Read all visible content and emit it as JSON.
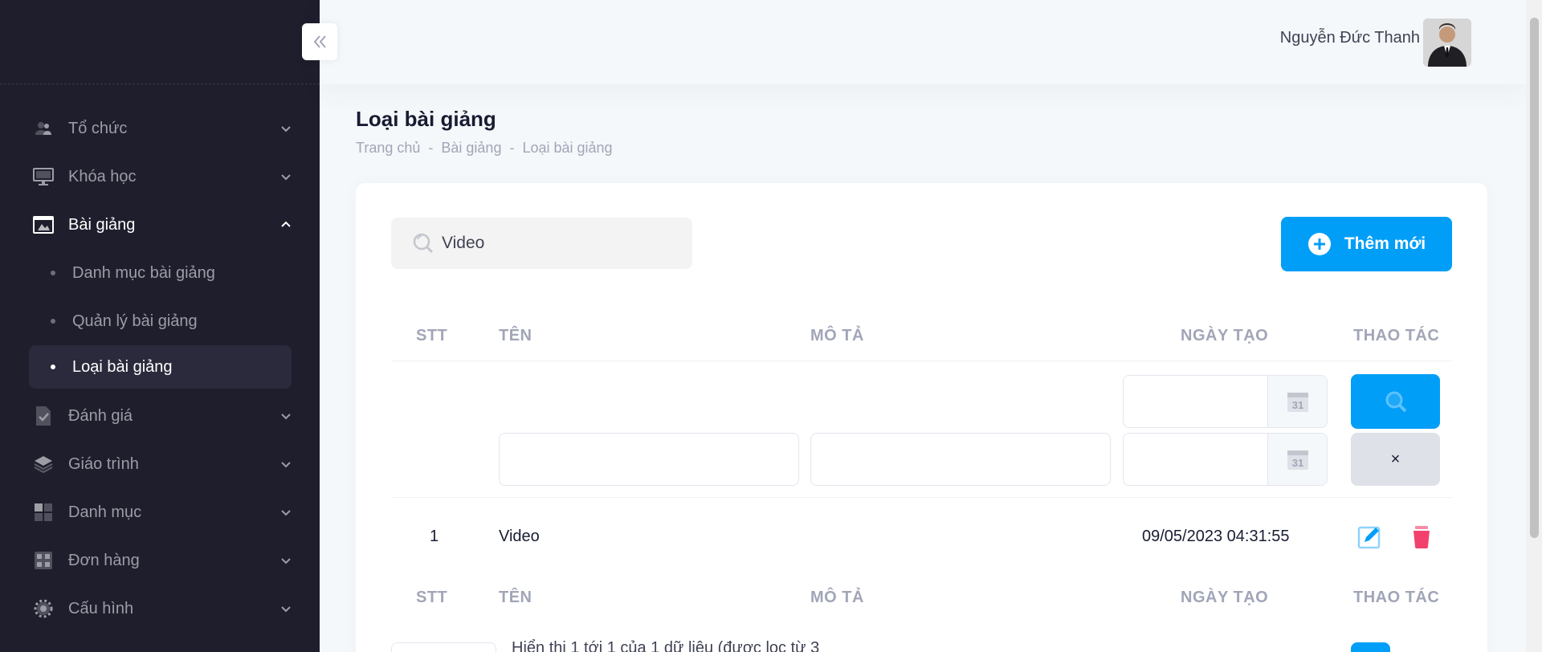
{
  "sidebar": {
    "items": [
      {
        "label": "Tổ chức",
        "icon": "users-icon"
      },
      {
        "label": "Khóa học",
        "icon": "monitor-icon"
      },
      {
        "label": "Bài giảng",
        "icon": "presentation-icon",
        "open": true,
        "children": [
          {
            "label": "Danh mục bài giảng"
          },
          {
            "label": "Quản lý bài giảng"
          },
          {
            "label": "Loại bài giảng",
            "active": true
          }
        ]
      },
      {
        "label": "Đánh giá",
        "icon": "document-check-icon"
      },
      {
        "label": "Giáo trình",
        "icon": "layers-icon"
      },
      {
        "label": "Danh mục",
        "icon": "grid-icon"
      },
      {
        "label": "Đơn hàng",
        "icon": "orders-icon"
      },
      {
        "label": "Cấu hình",
        "icon": "gear-icon"
      }
    ]
  },
  "header": {
    "user_name": "Nguyễn Đức Thanh"
  },
  "page": {
    "title": "Loại bài giảng",
    "breadcrumb": [
      "Trang chủ",
      "-",
      "Bài giảng",
      "-",
      "Loại bài giảng"
    ]
  },
  "toolbar": {
    "search_value": "Video",
    "add_label": "Thêm mới"
  },
  "table": {
    "columns": [
      "STT",
      "TÊN",
      "MÔ TẢ",
      "NGÀY TẠO",
      "THAO TÁC"
    ],
    "calendar_label": "31",
    "clear_label": "×",
    "rows": [
      {
        "stt": "1",
        "name": "Video",
        "description": "",
        "created": "09/05/2023 04:31:55"
      }
    ],
    "footer_info": "Hiển thị 1 tới 1 của 1 dữ liệu (được lọc từ 3"
  },
  "colors": {
    "primary": "#009ef7",
    "sidebar_bg": "#1e1e2d",
    "danger": "#f1416c"
  }
}
